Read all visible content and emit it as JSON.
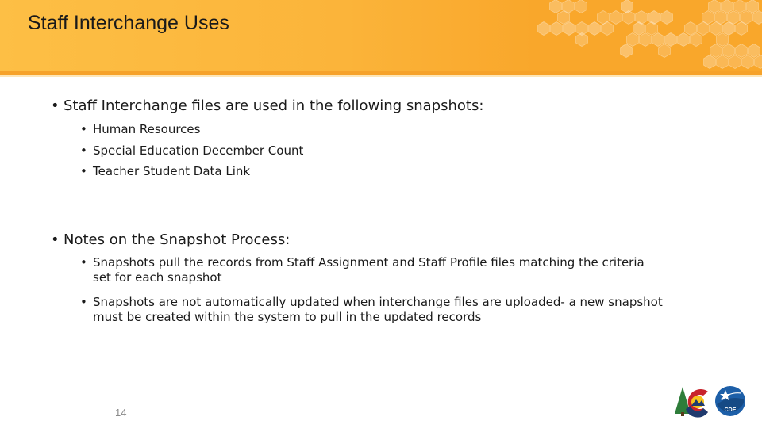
{
  "slide": {
    "title": "Staff Interchange Uses",
    "page_number": "14"
  },
  "sections": [
    {
      "label": "Staff Interchange files are used in the following snapshots:",
      "items": [
        "Human Resources",
        "Special Education December Count",
        "Teacher Student Data Link"
      ]
    },
    {
      "label": "Notes on the Snapshot Process:",
      "items": [
        [
          "Snapshots pull the records from Staff Assignment and Staff Profile files matching the criteria",
          "set for each snapshot"
        ],
        [
          "Snapshots are not automatically updated when interchange files are uploaded- a new snapshot",
          "must be created within the system to pull in the updated records"
        ]
      ]
    }
  ],
  "bullet_glyph": "•",
  "logos": {
    "colorado_logo_label": "Colorado state logo",
    "cde_logo_text": "CDE"
  },
  "colors": {
    "header_orange": "#fbb43a",
    "header_band": "#f6a22a",
    "text": "#1a1a1a",
    "page_number": "#8a8a8a"
  }
}
